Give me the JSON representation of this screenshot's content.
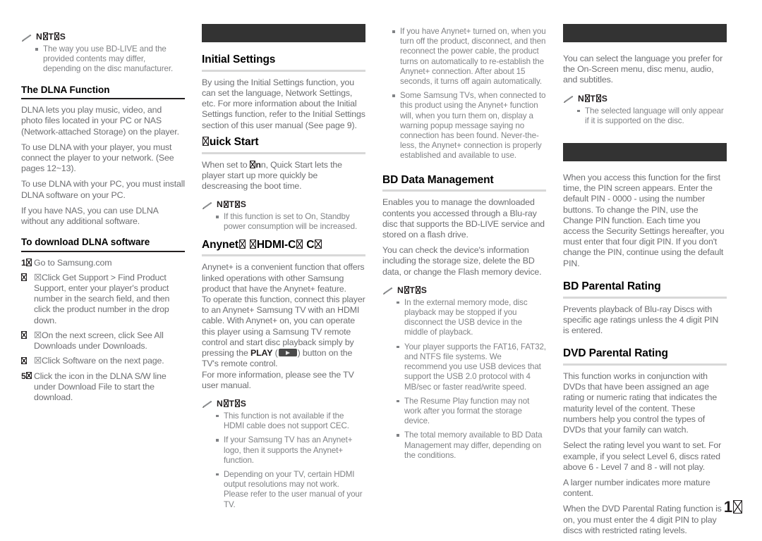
{
  "page": {
    "number_text": "1",
    "number_suffix_glyph": "missing-glyph"
  },
  "icons": {
    "notes_pencil": "pencil-icon",
    "play_button": "play-button-icon"
  },
  "colors": {
    "banner": "#333333",
    "heading_ink": "#231f20",
    "body_text": "#6d6e71",
    "note_text": "#808285",
    "rule_dark": "#231f20",
    "rule_light": "#d8d8d8"
  },
  "column1": {
    "notes_top": {
      "title": "N☒T☒S",
      "items": [
        "The way you use BD-LIVE and the provided contents may differ, depending on the disc manufacturer."
      ]
    },
    "dlna": {
      "heading": "The DLNA Function",
      "paragraphs": [
        "DLNA lets you play music, video, and photo files located in your PC or NAS (Network-attached Storage) on the player.",
        "To use DLNA with your player, you must connect the player to your network. (See pages 12~13).",
        "To use DLNA with your PC, you must install DLNA software on your PC.",
        "If you have NAS, you can use DLNA without any additional software."
      ]
    },
    "download": {
      "heading": "To download DLNA software",
      "steps": [
        {
          "num": "1",
          "num_has_glyph": true,
          "text": "Go to Samsung.com"
        },
        {
          "num": "☒",
          "num_has_glyph": true,
          "text": "☒Click Get Support > Find Product Support, enter your player's product number in the search field, and then click the product number in the drop down."
        },
        {
          "num": "☒",
          "num_has_glyph": true,
          "text": "☒On the next screen, click See All Downloads under Downloads."
        },
        {
          "num": "☒",
          "num_has_glyph": true,
          "text": "☒Click Software on the next page."
        },
        {
          "num": "5",
          "num_has_glyph": true,
          "text": "Click the icon in the DLNA S/W line under Download File to start the download."
        }
      ]
    }
  },
  "column2": {
    "banner": "",
    "initial_settings": {
      "heading": "Initial Settings",
      "paragraphs": [
        "By using the Initial Settings function, you can set the language, Network Settings, etc. For more information about the Initial Settings function, refer to the Initial Settings section of this user manual (See page 9)."
      ]
    },
    "quick_start": {
      "heading_prefix": "",
      "heading_text": "uick Start",
      "paragraphs_pre": "When set to ",
      "paragraphs_post": "n, Quick Start lets the player start up more quickly be descreasing the boot time.",
      "notes": {
        "title": "N☒T☒S",
        "items": [
          "If this function is set to On, Standby power consumption will be increased."
        ]
      }
    },
    "anynet": {
      "heading_part1": "Anynet",
      "heading_part2": "HDMI-C",
      "heading_part3": "C",
      "paragraph_a": "Anynet+ is a convenient function that offers linked operations with other Samsung product that have the Anynet+ feature.",
      "paragraph_b_pre": "To operate this function, connect this player to an Anynet+ Samsung TV with an HDMI cable. With Anynet+ on, you can operate this player using a Samsung TV remote control and start disc playback simply by pressing the ",
      "play_label": "PLAY",
      "paragraph_b_post": ") button on the TV's remote control.",
      "paragraph_c": "For more information, please see the TV user manual.",
      "notes": {
        "title": "N☒T☒S",
        "items": [
          "This function is not available if the HDMI cable does not support CEC.",
          "If your Samsung TV has an Anynet+ logo, then it supports the Anynet+ function.",
          "Depending on your TV, certain HDMI output resolutions may not work. Please refer to the user manual of your TV."
        ]
      }
    }
  },
  "column3": {
    "top_notes": {
      "items": [
        "If you have Anynet+ turned on, when you turn off the product, disconnect, and then reconnect the power cable, the product turns on automatically to re-establish the Anynet+ connection. After about 15 seconds, it turns off again automatically.",
        "Some Samsung TVs, when connected to this product using the Anynet+ function will, when you turn them on, display a warning popup message saying no connection has been found. Never-the-less, the Anynet+ connection is properly established and available to use."
      ]
    },
    "bd_data": {
      "heading": "BD Data Management",
      "paragraphs": [
        "Enables you to manage the downloaded contents you accessed through a Blu-ray disc that supports the BD-LIVE service and stored on a flash drive.",
        "You can check the device's information including the storage size, delete the BD data, or change the Flash memory device."
      ],
      "notes": {
        "title": "N☒T☒S",
        "items": [
          "In the external memory mode, disc playback may be stopped if you disconnect the USB device in the middle of playback.",
          "Your player supports the FAT16, FAT32, and NTFS file systems. We recommend you use USB devices that support the USB 2.0 protocol with 4 MB/sec or faster read/write speed.",
          "The Resume Play function may not work after you format the storage device.",
          "The total memory available to BD Data Management may differ, depending on the conditions."
        ]
      }
    }
  },
  "column4": {
    "banner_language": "",
    "language": {
      "paragraphs": [
        "You can select the language you prefer for the On-Screen menu, disc menu, audio, and subtitles."
      ],
      "notes": {
        "title": "N☒T☒S",
        "items": [
          "The selected language will only appear if it is supported on the disc."
        ]
      }
    },
    "banner_security": "",
    "security": {
      "paragraphs": [
        "When you access this function for the first time, the PIN screen appears. Enter the default PIN - 0000 - using the number buttons. To change the PIN, use the Change PIN function. Each time you access the Security Settings hereafter, you must enter that four digit PIN. If you don't change the PIN, continue using the default PIN."
      ]
    },
    "bd_parental": {
      "heading": "BD Parental Rating",
      "paragraphs": [
        "Prevents playback of Blu-ray Discs with specific age ratings unless the 4 digit PIN is entered."
      ]
    },
    "dvd_parental": {
      "heading": "DVD Parental Rating",
      "paragraphs": [
        "This function works in conjunction with DVDs that have been assigned an age rating or numeric rating that indicates the maturity level of the content. These numbers help you control the types of DVDs that your family can watch.",
        "Select the rating level you want to set. For example, if you select Level 6, discs rated above 6 - Level 7 and 8 - will not play.",
        "A larger number indicates more mature content.",
        "When the DVD Parental Rating function is on, you must enter the 4 digit PIN to play discs with restricted rating levels."
      ]
    }
  }
}
